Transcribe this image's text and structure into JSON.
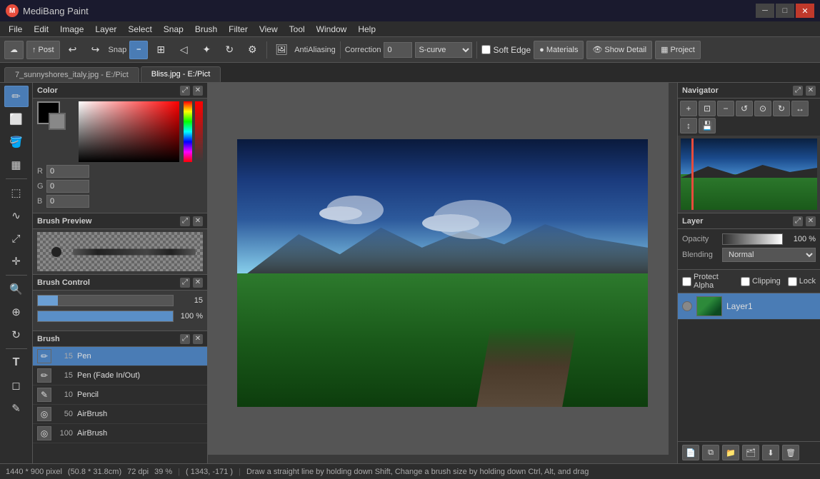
{
  "app": {
    "title": "MediBang Paint",
    "icon": "M"
  },
  "window_controls": {
    "minimize": "─",
    "maximize": "□",
    "close": "✕"
  },
  "menu": {
    "items": [
      "File",
      "Edit",
      "Image",
      "Layer",
      "Select",
      "Snap",
      "Brush",
      "Filter",
      "View",
      "Tool",
      "Window",
      "Help"
    ]
  },
  "toolbar": {
    "post_label": "Post",
    "snap_label": "Snap",
    "antialias_label": "AntiAliasing",
    "correction_label": "Correction",
    "correction_value": "0",
    "soft_edge_label": "Soft Edge",
    "materials_label": "Materials",
    "show_detail_label": "Show Detail",
    "project_label": "Project"
  },
  "tabs": [
    {
      "label": "7_sunnyshores_italy.jpg - E:/Pict",
      "active": false
    },
    {
      "label": "Bliss.jpg - E:/Pict",
      "active": true
    }
  ],
  "color_panel": {
    "title": "Color",
    "r_label": "R",
    "g_label": "G",
    "b_label": "B",
    "r_value": "0",
    "g_value": "0",
    "b_value": "0"
  },
  "brush_preview": {
    "title": "Brush Preview"
  },
  "brush_control": {
    "title": "Brush Control",
    "size_value": "15",
    "opacity_value": "100 %"
  },
  "brush_list": {
    "title": "Brush",
    "items": [
      {
        "size": "15",
        "name": "Pen",
        "active": true
      },
      {
        "size": "15",
        "name": "Pen (Fade In/Out)",
        "active": false
      },
      {
        "size": "10",
        "name": "Pencil",
        "active": false
      },
      {
        "size": "50",
        "name": "AirBrush",
        "active": false
      },
      {
        "size": "100",
        "name": "AirBrush",
        "active": false
      }
    ]
  },
  "navigator": {
    "title": "Navigator"
  },
  "layer_panel": {
    "title": "Layer",
    "opacity_label": "Opacity",
    "opacity_value": "100 %",
    "blending_label": "Blending",
    "blending_value": "Normal",
    "protect_alpha": "Protect Alpha",
    "clipping": "Clipping",
    "lock": "Lock",
    "layer1_name": "Layer1"
  },
  "status_bar": {
    "dimensions": "1440 * 900 pixel",
    "size_cm": "(50.8 * 31.8cm)",
    "dpi": "72 dpi",
    "zoom": "39 %",
    "coordinates": "( 1343, -171 )",
    "hint": "Draw a straight line by holding down Shift, Change a brush size by holding down Ctrl, Alt, and drag"
  }
}
